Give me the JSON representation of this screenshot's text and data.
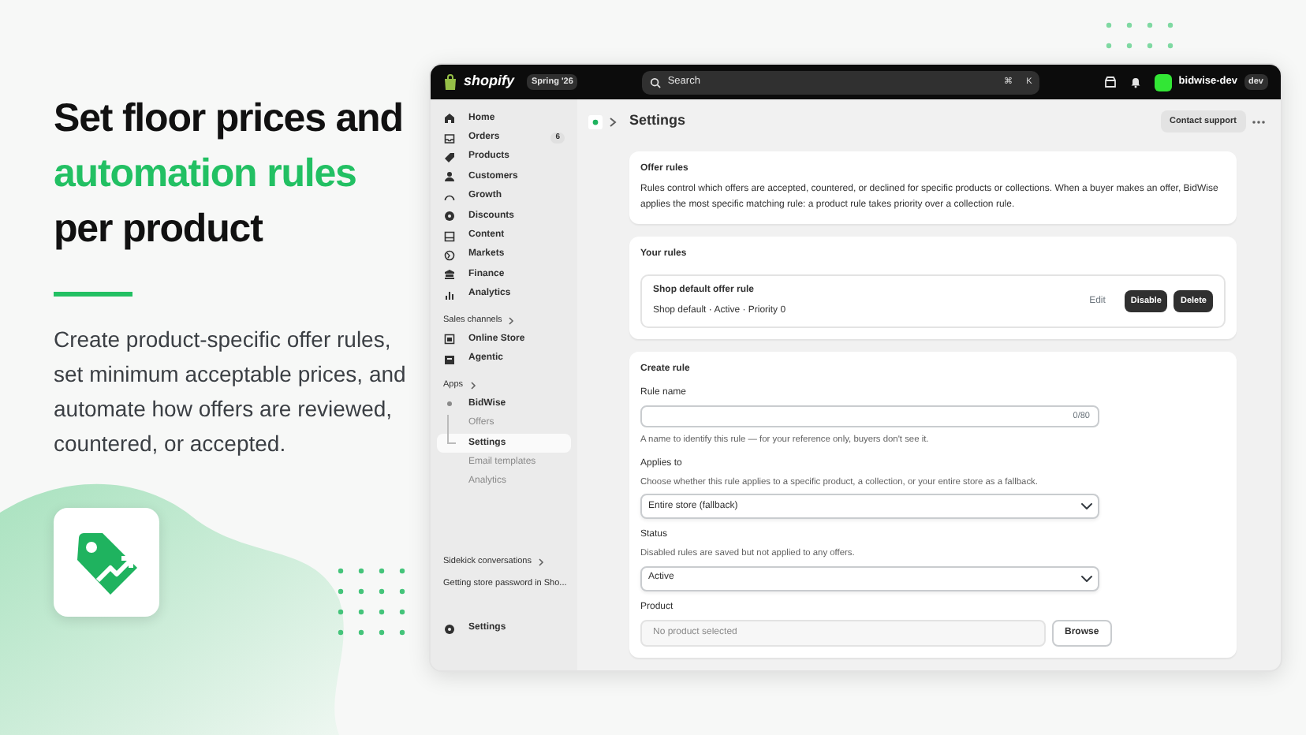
{
  "hero": {
    "headline": [
      {
        "text": "Set floor prices and",
        "accent": false
      },
      {
        "text": "automation rules",
        "accent": true
      },
      {
        "text": "per product",
        "accent": false
      }
    ],
    "description": "Create product-specific offer rules, set minimum acceptable prices, and automate how offers are reviewed, countered, or accepted."
  },
  "admin": {
    "topbar": {
      "logo": "shopify",
      "version": "Spring '26",
      "search_placeholder": "Search",
      "shortcut": [
        "⌘",
        "K"
      ],
      "store_name": "bidwise-dev",
      "store_badge": "dev"
    },
    "sidebar": {
      "items": [
        {
          "label": "Home"
        },
        {
          "label": "Orders",
          "badge": "6"
        },
        {
          "label": "Products"
        },
        {
          "label": "Customers"
        },
        {
          "label": "Growth"
        },
        {
          "label": "Discounts"
        },
        {
          "label": "Content"
        },
        {
          "label": "Markets"
        },
        {
          "label": "Finance"
        },
        {
          "label": "Analytics"
        }
      ],
      "sales_channels_heading": "Sales channels",
      "channels": [
        {
          "label": "Online Store"
        },
        {
          "label": "Agentic"
        }
      ],
      "apps_heading": "Apps",
      "app": {
        "label": "BidWise",
        "children": [
          {
            "label": "Offers",
            "selected": false
          },
          {
            "label": "Settings",
            "selected": true
          },
          {
            "label": "Email templates",
            "selected": false
          },
          {
            "label": "Analytics",
            "selected": false
          }
        ]
      },
      "sidekick_heading": "Sidekick conversations",
      "conversations": [
        "Getting store password in Sho..."
      ],
      "settings": "Settings"
    },
    "page": {
      "breadcrumb": "Settings",
      "contact_button": "Contact support",
      "offer_rules": {
        "title": "Offer rules",
        "description": "Rules control which offers are accepted, countered, or declined for specific products or collections. When a buyer makes an offer, BidWise applies the most specific matching rule: a product rule takes priority over a collection rule."
      },
      "your_rules": {
        "title": "Your rules",
        "rules": [
          {
            "name": "Shop default offer rule",
            "meta": "Shop default · Active · Priority 0",
            "edit": "Edit",
            "actions": [
              "Disable",
              "Delete"
            ]
          }
        ]
      },
      "create_rule": {
        "title": "Create rule",
        "fields": [
          {
            "kind": "text",
            "label": "Rule name",
            "counter": "0/80",
            "help": "A name to identify this rule — for your reference only, buyers don't see it."
          },
          {
            "kind": "select",
            "label": "Applies to",
            "help": "Choose whether this rule applies to a specific product, a collection, or your entire store as a fallback.",
            "value": "Entire store (fallback)"
          },
          {
            "kind": "select",
            "label": "Status",
            "help": "Disabled rules are saved but not applied to any offers.",
            "value": "Active"
          },
          {
            "kind": "picker",
            "label": "Product",
            "placeholder": "No product selected",
            "button": "Browse"
          }
        ]
      }
    }
  }
}
